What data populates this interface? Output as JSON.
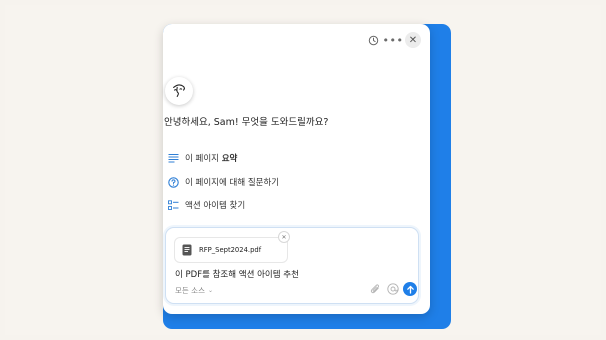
{
  "greeting": "안녕하세요, Sam! 무엇을 도와드릴까요?",
  "actions": [
    {
      "icon": "summary-lines-icon",
      "label": "이 페이지 ",
      "label_bold": "요약"
    },
    {
      "icon": "question-circle-icon",
      "label": "이 페이지에 대해 질문하기"
    },
    {
      "icon": "checklist-icon",
      "label": "액션 아이템 찾기"
    }
  ],
  "composer": {
    "attachment_name": "RFP_Sept2024.pdf",
    "input_text": "이 PDF를 참조해 액션 아이템 추천",
    "source_label": "모든 소스"
  },
  "toolbar_icons": [
    "history-icon",
    "more-icon",
    "close-icon"
  ],
  "colors": {
    "accent": "#1f7fe8",
    "background": "#f6f3ee",
    "panel": "#ffffff"
  }
}
